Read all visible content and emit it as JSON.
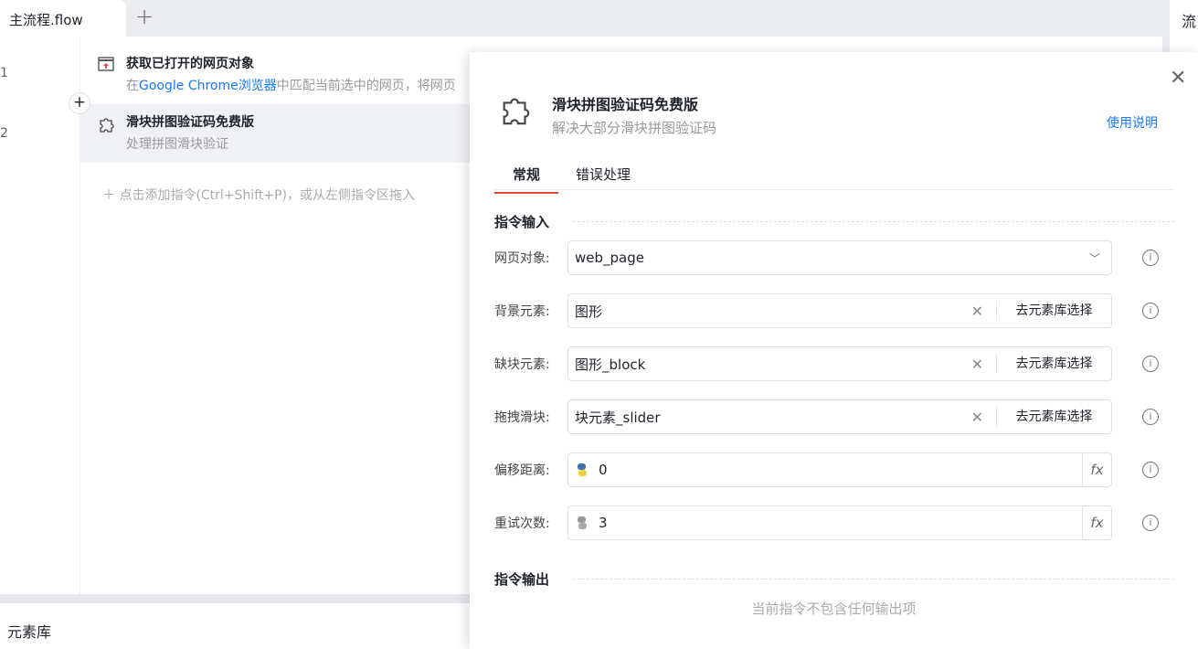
{
  "tabs": {
    "active": "主流程.flow",
    "add": "+"
  },
  "right_panel": {
    "title": "流"
  },
  "steps": [
    {
      "line": "1",
      "title": "获取已打开的网页对象",
      "desc_prefix": "在",
      "desc_link": "Google Chrome浏览器",
      "desc_rest": "中匹配当前选中的网页，将网页"
    },
    {
      "line": "2",
      "title": "滑块拼图验证码免费版",
      "desc": "处理拼图滑块验证"
    }
  ],
  "add_command": "＋ 点击添加指令(Ctrl+Shift+P)，或从左侧指令区拖入",
  "element_library": "元素库",
  "modal": {
    "title": "滑块拼图验证码免费版",
    "subtitle": "解决大部分滑块拼图验证码",
    "help": "使用说明",
    "tabs": [
      "常规",
      "错误处理"
    ],
    "input_section": "指令输入",
    "output_section": "指令输出",
    "no_output": "当前指令不包含任何输出项",
    "pick_label": "去元素库选择",
    "fields": [
      {
        "label": "网页对象:",
        "value": "web_page"
      },
      {
        "label": "背景元素:",
        "value": "图形"
      },
      {
        "label": "缺块元素:",
        "value": "图形_block"
      },
      {
        "label": "拖拽滑块:",
        "value": "块元素_slider"
      },
      {
        "label": "偏移距离:",
        "value": "0"
      },
      {
        "label": "重试次数:",
        "value": "3"
      }
    ],
    "fx": "fx"
  }
}
